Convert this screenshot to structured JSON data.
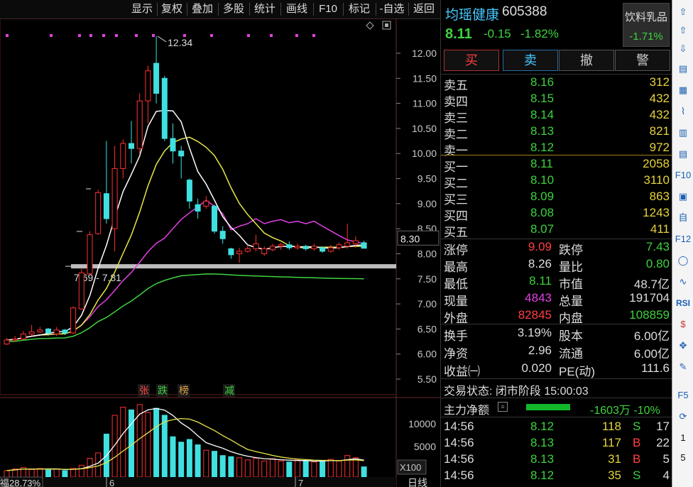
{
  "toolbar": {
    "items": [
      "显示",
      "复权",
      "叠加",
      "多股",
      "统计",
      "画线",
      "F10",
      "标记",
      "-自选",
      "返回"
    ]
  },
  "chart": {
    "price_axis": [
      "12.00",
      "11.50",
      "11.00",
      "10.50",
      "10.00",
      "9.50",
      "9.00",
      "8.50",
      "8.00",
      "7.50",
      "7.00",
      "6.50",
      "6.00",
      "5.50"
    ],
    "high_label": "12.34",
    "range_label": "7.69 - 7.81",
    "current_price_tag": "8.30",
    "markers": [
      "张",
      "跌",
      "榜",
      "减"
    ],
    "volume_axis": [
      "10000",
      "5000"
    ],
    "volume_unit": "X100",
    "period_label": "日线",
    "bottom_left_label": "福28.73%",
    "date_labels": [
      "6",
      "7"
    ],
    "colors": {
      "up": "#ff3030",
      "down": "#40e0e0",
      "ma5": "#ffffff",
      "ma10": "#e6e64a",
      "ma20": "#e040e0",
      "ma60": "#3ed23e"
    }
  },
  "chart_data": {
    "type": "candlestick",
    "ylim": [
      5.3,
      12.6
    ],
    "candles": [
      {
        "o": 6.2,
        "c": 6.28,
        "h": 6.32,
        "l": 6.18
      },
      {
        "o": 6.28,
        "c": 6.3,
        "h": 6.36,
        "l": 6.24
      },
      {
        "o": 6.3,
        "c": 6.4,
        "h": 6.46,
        "l": 6.28
      },
      {
        "o": 6.4,
        "c": 6.44,
        "h": 6.58,
        "l": 6.36
      },
      {
        "o": 6.44,
        "c": 6.48,
        "h": 6.54,
        "l": 6.42
      },
      {
        "o": 6.5,
        "c": 6.42,
        "h": 6.52,
        "l": 6.36
      },
      {
        "o": 6.4,
        "c": 6.48,
        "h": 6.54,
        "l": 6.36
      },
      {
        "o": 6.48,
        "c": 6.42,
        "h": 6.5,
        "l": 6.38
      },
      {
        "o": 6.42,
        "c": 6.92,
        "h": 6.95,
        "l": 6.4
      },
      {
        "o": 6.9,
        "c": 7.62,
        "h": 7.7,
        "l": 6.88
      },
      {
        "o": 7.6,
        "c": 8.38,
        "h": 8.45,
        "l": 7.58
      },
      {
        "o": 8.4,
        "c": 9.22,
        "h": 9.28,
        "l": 8.38
      },
      {
        "o": 9.2,
        "c": 8.7,
        "h": 10.25,
        "l": 8.6
      },
      {
        "o": 8.5,
        "c": 9.7,
        "h": 10.15,
        "l": 8.05
      },
      {
        "o": 9.7,
        "c": 10.2,
        "h": 10.28,
        "l": 9.5
      },
      {
        "o": 10.2,
        "c": 10.1,
        "h": 10.65,
        "l": 9.8
      },
      {
        "o": 10.1,
        "c": 11.05,
        "h": 11.2,
        "l": 10.0
      },
      {
        "o": 11.05,
        "c": 11.65,
        "h": 11.75,
        "l": 10.6
      },
      {
        "o": 11.8,
        "c": 11.2,
        "h": 12.34,
        "l": 11.0
      },
      {
        "o": 11.5,
        "c": 10.3,
        "h": 11.55,
        "l": 10.25
      },
      {
        "o": 10.3,
        "c": 10.05,
        "h": 10.6,
        "l": 9.8
      },
      {
        "o": 10.05,
        "c": 9.95,
        "h": 10.15,
        "l": 9.5
      },
      {
        "o": 9.47,
        "c": 9.05,
        "h": 9.5,
        "l": 8.9
      },
      {
        "o": 8.98,
        "c": 8.85,
        "h": 9.1,
        "l": 8.7
      },
      {
        "o": 8.95,
        "c": 9.05,
        "h": 9.15,
        "l": 8.9
      },
      {
        "o": 8.95,
        "c": 8.45,
        "h": 8.98,
        "l": 8.4
      },
      {
        "o": 8.45,
        "c": 8.3,
        "h": 8.55,
        "l": 8.2
      },
      {
        "o": 8.1,
        "c": 7.98,
        "h": 8.12,
        "l": 7.9
      },
      {
        "o": 8.0,
        "c": 8.05,
        "h": 8.12,
        "l": 7.82
      },
      {
        "o": 8.05,
        "c": 8.1,
        "h": 8.18,
        "l": 8.02
      },
      {
        "o": 8.1,
        "c": 8.2,
        "h": 8.38,
        "l": 8.05
      },
      {
        "o": 8.0,
        "c": 8.1,
        "h": 8.15,
        "l": 7.96
      },
      {
        "o": 8.08,
        "c": 8.15,
        "h": 8.2,
        "l": 8.05
      },
      {
        "o": 8.15,
        "c": 8.18,
        "h": 8.22,
        "l": 8.08
      },
      {
        "o": 8.18,
        "c": 8.12,
        "h": 8.25,
        "l": 8.08
      },
      {
        "o": 8.12,
        "c": 8.15,
        "h": 8.2,
        "l": 8.08
      },
      {
        "o": 8.15,
        "c": 8.1,
        "h": 8.18,
        "l": 8.06
      },
      {
        "o": 8.1,
        "c": 8.15,
        "h": 8.2,
        "l": 8.06
      },
      {
        "o": 8.12,
        "c": 8.05,
        "h": 8.15,
        "l": 8.02
      },
      {
        "o": 8.05,
        "c": 8.12,
        "h": 8.18,
        "l": 8.02
      },
      {
        "o": 8.12,
        "c": 8.18,
        "h": 8.22,
        "l": 8.08
      },
      {
        "o": 8.15,
        "c": 8.22,
        "h": 8.6,
        "l": 8.1
      },
      {
        "o": 8.2,
        "c": 8.26,
        "h": 8.35,
        "l": 8.12
      },
      {
        "o": 8.22,
        "c": 8.11,
        "h": 8.26,
        "l": 8.11
      }
    ],
    "volume": [
      1.2,
      1.5,
      1.8,
      1.4,
      1.6,
      1.3,
      1.5,
      1.2,
      1.6,
      2.2,
      3.5,
      4.5,
      8.0,
      11.5,
      13.0,
      12.5,
      13.5,
      12.0,
      12.8,
      11.5,
      7.5,
      6.5,
      7.0,
      6.0,
      5.0,
      4.8,
      4.0,
      3.8,
      3.6,
      3.2,
      3.5,
      3.0,
      3.4,
      3.0,
      2.8,
      3.2,
      3.0,
      2.8,
      3.1,
      3.3,
      3.0,
      4.0,
      3.6,
      1.9
    ],
    "ma_lines": [
      "ma5",
      "ma10",
      "ma20",
      "ma60"
    ],
    "support_level": 7.75
  },
  "quote": {
    "name": "均瑶健康",
    "code": "605388",
    "price": "8.11",
    "change": "-0.15",
    "change_pct": "-1.82%",
    "industry": "饮料乳品",
    "industry_pct": "-1.71%",
    "buttons": [
      "买",
      "卖",
      "撤",
      "警"
    ],
    "asks": [
      {
        "label": "卖五",
        "price": "8.16",
        "vol": "312"
      },
      {
        "label": "卖四",
        "price": "8.15",
        "vol": "432"
      },
      {
        "label": "卖三",
        "price": "8.14",
        "vol": "432"
      },
      {
        "label": "卖二",
        "price": "8.13",
        "vol": "821"
      },
      {
        "label": "卖一",
        "price": "8.12",
        "vol": "972"
      }
    ],
    "bids": [
      {
        "label": "买一",
        "price": "8.11",
        "vol": "2058"
      },
      {
        "label": "买二",
        "price": "8.10",
        "vol": "3110"
      },
      {
        "label": "买三",
        "price": "8.09",
        "vol": "863"
      },
      {
        "label": "买四",
        "price": "8.08",
        "vol": "1243"
      },
      {
        "label": "买五",
        "price": "8.07",
        "vol": "411"
      }
    ],
    "stats": [
      {
        "l1": "涨停",
        "v1": "9.09",
        "c1": "red",
        "l2": "跌停",
        "v2": "7.43",
        "c2": "green"
      },
      {
        "l1": "最高",
        "v1": "8.26",
        "c1": "white",
        "l2": "量比",
        "v2": "0.80",
        "c2": "green"
      },
      {
        "l1": "最低",
        "v1": "8.11",
        "c1": "green",
        "l2": "市值",
        "v2": "48.7亿",
        "c2": "white"
      },
      {
        "l1": "现量",
        "v1": "4843",
        "c1": "magenta",
        "l2": "总量",
        "v2": "191704",
        "c2": "white"
      },
      {
        "l1": "外盘",
        "v1": "82845",
        "c1": "red",
        "l2": "内盘",
        "v2": "108859",
        "c2": "green"
      }
    ],
    "stats2": [
      {
        "l1": "换手",
        "v1": "3.19%",
        "l2": "股本",
        "v2": "6.00亿"
      },
      {
        "l1": "净资",
        "v1": "2.96",
        "l2": "流通",
        "v2": "6.00亿"
      },
      {
        "l1": "收益㈠",
        "v1": "0.020",
        "l2": "PE(动)",
        "v2": "111.6"
      }
    ],
    "trade_status": "交易状态: 闭市阶段 15:00:03",
    "main_flow_label": "主力净额",
    "main_flow_value": "-1603万 -10%",
    "ticks": [
      {
        "t": "14:56",
        "p": "8.12",
        "v": "118",
        "s": "S",
        "n": "17"
      },
      {
        "t": "14:56",
        "p": "8.13",
        "v": "117",
        "s": "B",
        "n": "22"
      },
      {
        "t": "14:56",
        "p": "8.13",
        "v": "31",
        "s": "B",
        "n": "5"
      },
      {
        "t": "14:56",
        "p": "8.12",
        "v": "35",
        "s": "S",
        "n": "4"
      }
    ]
  },
  "iconbar": {
    "items": [
      "up-arrow-icon",
      "up-outline-icon",
      "down-outline-icon",
      "report-icon",
      "table-icon",
      "trend-icon",
      "kline-icon",
      "list-icon",
      "f10-icon",
      "news-icon",
      "self-icon",
      "f12-icon",
      "circle-icon",
      "wave-icon",
      "rsi-icon",
      "dollar-icon",
      "move-icon",
      "pen-icon",
      "f5-icon",
      "refresh-icon"
    ],
    "labels": [
      "⇧",
      "⇧",
      "⇩",
      "▤",
      "▦",
      "⌇",
      "▥",
      "▤",
      "F10",
      "▣",
      "自",
      "F12",
      "◯",
      "∿",
      "RSI",
      "$",
      "✥",
      "✎",
      "F5",
      "⟳"
    ],
    "footer": [
      "1",
      "5"
    ]
  }
}
